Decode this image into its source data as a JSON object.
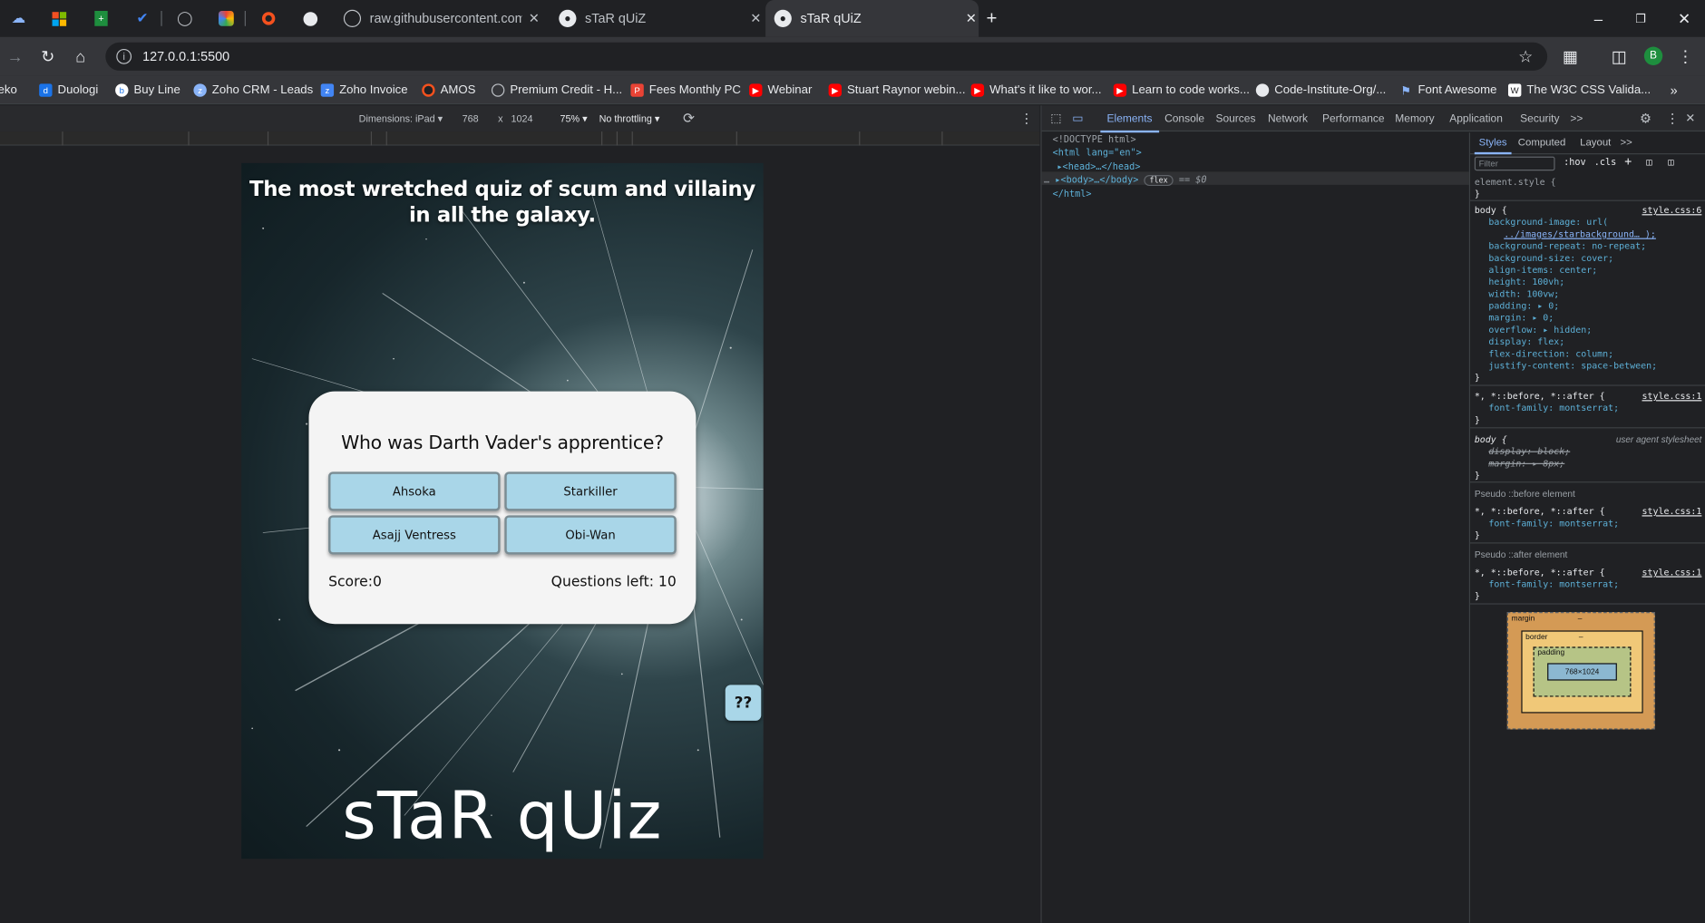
{
  "browser": {
    "tabs": [
      {
        "title": "raw.githubusercontent.com/All",
        "active": false
      },
      {
        "title": "sTaR qUiZ",
        "active": false
      },
      {
        "title": "sTaR qUiZ",
        "active": true
      }
    ],
    "new_tab_symbol": "+",
    "url": "127.0.0.1:5500",
    "profile_initial": "B",
    "bookmarks": [
      {
        "label": "Deko",
        "icon": "deko-icon"
      },
      {
        "label": "Duologi",
        "icon": "duologi-icon"
      },
      {
        "label": "Buy Line",
        "icon": "buyline-icon"
      },
      {
        "label": "Zoho CRM - Leads",
        "icon": "zoho-icon"
      },
      {
        "label": "Zoho Invoice",
        "icon": "zoho-invoice-icon"
      },
      {
        "label": "AMOS",
        "icon": "amos-icon"
      },
      {
        "label": "Premium Credit - H...",
        "icon": "globe-icon"
      },
      {
        "label": "Fees Monthly PC",
        "icon": "fees-icon"
      },
      {
        "label": "Webinar",
        "icon": "youtube-icon"
      },
      {
        "label": "Stuart Raynor webin...",
        "icon": "youtube-icon"
      },
      {
        "label": "What's it like to wor...",
        "icon": "youtube-icon"
      },
      {
        "label": "Learn to code works...",
        "icon": "youtube-icon"
      },
      {
        "label": "Code-Institute-Org/...",
        "icon": "github-icon"
      },
      {
        "label": "Font Awesome",
        "icon": "flag-icon"
      },
      {
        "label": "The W3C CSS Valida...",
        "icon": "w3c-icon"
      }
    ]
  },
  "device_toolbar": {
    "dimensions_label": "Dimensions: iPad",
    "width": "768",
    "times": "x",
    "height": "1024",
    "zoom": "75%",
    "throttling": "No throttling"
  },
  "app": {
    "heading": "The most wretched quiz of scum and villainy in all the galaxy.",
    "question": "Who was Darth Vader's apprentice?",
    "answers": [
      "Ahsoka",
      "Starkiller",
      "Asajj Ventress",
      "Obi-Wan"
    ],
    "score": "Score:0",
    "questions_left": "Questions left: 10",
    "help_label": "??",
    "logo": "sTaR qUiz"
  },
  "devtools": {
    "tabs": [
      "Elements",
      "Console",
      "Sources",
      "Network",
      "Performance",
      "Memory",
      "Application",
      "Security"
    ],
    "more": ">>",
    "dom": {
      "doctype": "<!DOCTYPE html>",
      "html_open": "<html lang=\"en\">",
      "head": "<head>…</head>",
      "body": "<body>…</body>",
      "body_badge": "flex",
      "body_ref": "== $0",
      "html_close": "</html>"
    },
    "styles_tabs": [
      "Styles",
      "Computed",
      "Layout"
    ],
    "filter_placeholder": "Filter",
    "hov": ":hov",
    "cls": ".cls",
    "element_style": "element.style {",
    "body_rule": {
      "selector": "body {",
      "source": "style.css:6",
      "decls": [
        "background-image: url(",
        "../images/starbackground… );",
        "background-repeat: no-repeat;",
        "background-size: cover;",
        "align-items: center;",
        "height: 100vh;",
        "width: 100vw;",
        "padding: ▸ 0;",
        "margin: ▸ 0;",
        "overflow: ▸ hidden;",
        "display: flex;",
        "flex-direction: column;",
        "justify-content: space-between;"
      ]
    },
    "universal_rule": {
      "selector": "*, *::before, *::after {",
      "source": "style.css:1",
      "decl": "font-family: montserrat;"
    },
    "ua_rule": {
      "selector": "body {",
      "source": "user agent stylesheet",
      "decls": [
        "display: block;",
        "margin: ▸ 8px;"
      ]
    },
    "pseudo_before": "Pseudo ::before element",
    "pseudo_after": "Pseudo ::after element",
    "close_brace": "}",
    "box_model": {
      "margin": "margin",
      "border": "border",
      "padding": "padding",
      "content": "768×1024",
      "dash": "–"
    }
  }
}
